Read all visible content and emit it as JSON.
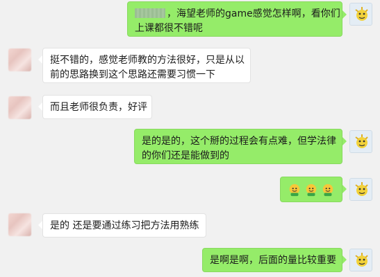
{
  "messages": [
    {
      "side": "out",
      "lines": [
        "，海望老师的game感觉怎样啊，看你们",
        "上课都很不错呢"
      ],
      "redacted_prefix": true
    },
    {
      "side": "in",
      "lines": [
        "挺不错的，感觉老师教的方法很好，只是从以",
        "前的思路换到这个思路还需要习惯一下"
      ]
    },
    {
      "side": "in",
      "lines": [
        "而且老师很负责，好评"
      ]
    },
    {
      "side": "out",
      "lines": [
        "是的是的，这个掰的过程会有点难，但学法律",
        "的你们还是能做到的"
      ]
    },
    {
      "side": "out",
      "emoji": [
        "smile-face-emoji",
        "smile-face-emoji",
        "smile-face-emoji"
      ]
    },
    {
      "side": "in",
      "lines": [
        "是的 还是要通过练习把方法用熟练"
      ]
    },
    {
      "side": "out",
      "lines": [
        "是啊是啊，后面的量比较重要"
      ]
    }
  ],
  "colors": {
    "background": "#f1f1f1",
    "outgoing_bubble": "#95ec69",
    "incoming_bubble": "#ffffff"
  }
}
